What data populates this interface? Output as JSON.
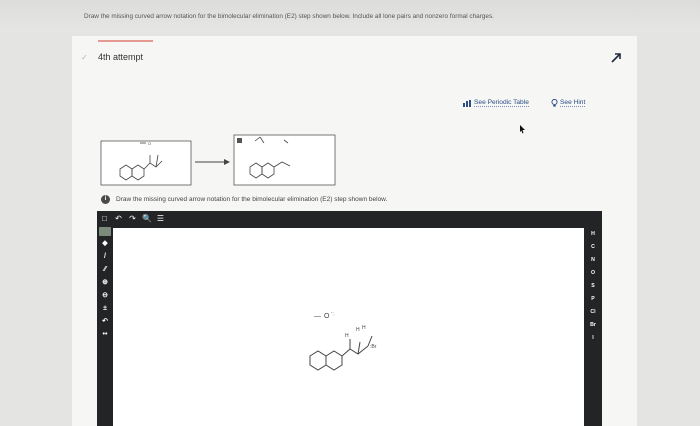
{
  "instructions": "Draw the missing curved arrow notation for the bimolecular elimination (E2) step shown below. Include all lone pairs and nonzero formal charges.",
  "attempt": {
    "label": "4th attempt"
  },
  "links": {
    "periodic_table": "See Periodic Table",
    "hint": "See Hint"
  },
  "reaction": {
    "arrow": "→"
  },
  "question_text": "Draw the missing curved arrow notation for the bimolecular elimination (E2) step shown below.",
  "toolbar": {
    "items": [
      "□",
      "↶",
      "↷",
      "🔍",
      "☰"
    ]
  },
  "left_tools": [
    "◆",
    "/",
    "⁄⁄",
    "⊕",
    "⊖",
    "±",
    "↶",
    "••"
  ],
  "right_tools": [
    "H",
    "C",
    "N",
    "O",
    "S",
    "P",
    "Cl",
    "Br",
    "I"
  ],
  "canvas_molecule": {
    "base_label": "—ÖḤ",
    "h_labels": "H",
    "charge": "+"
  }
}
